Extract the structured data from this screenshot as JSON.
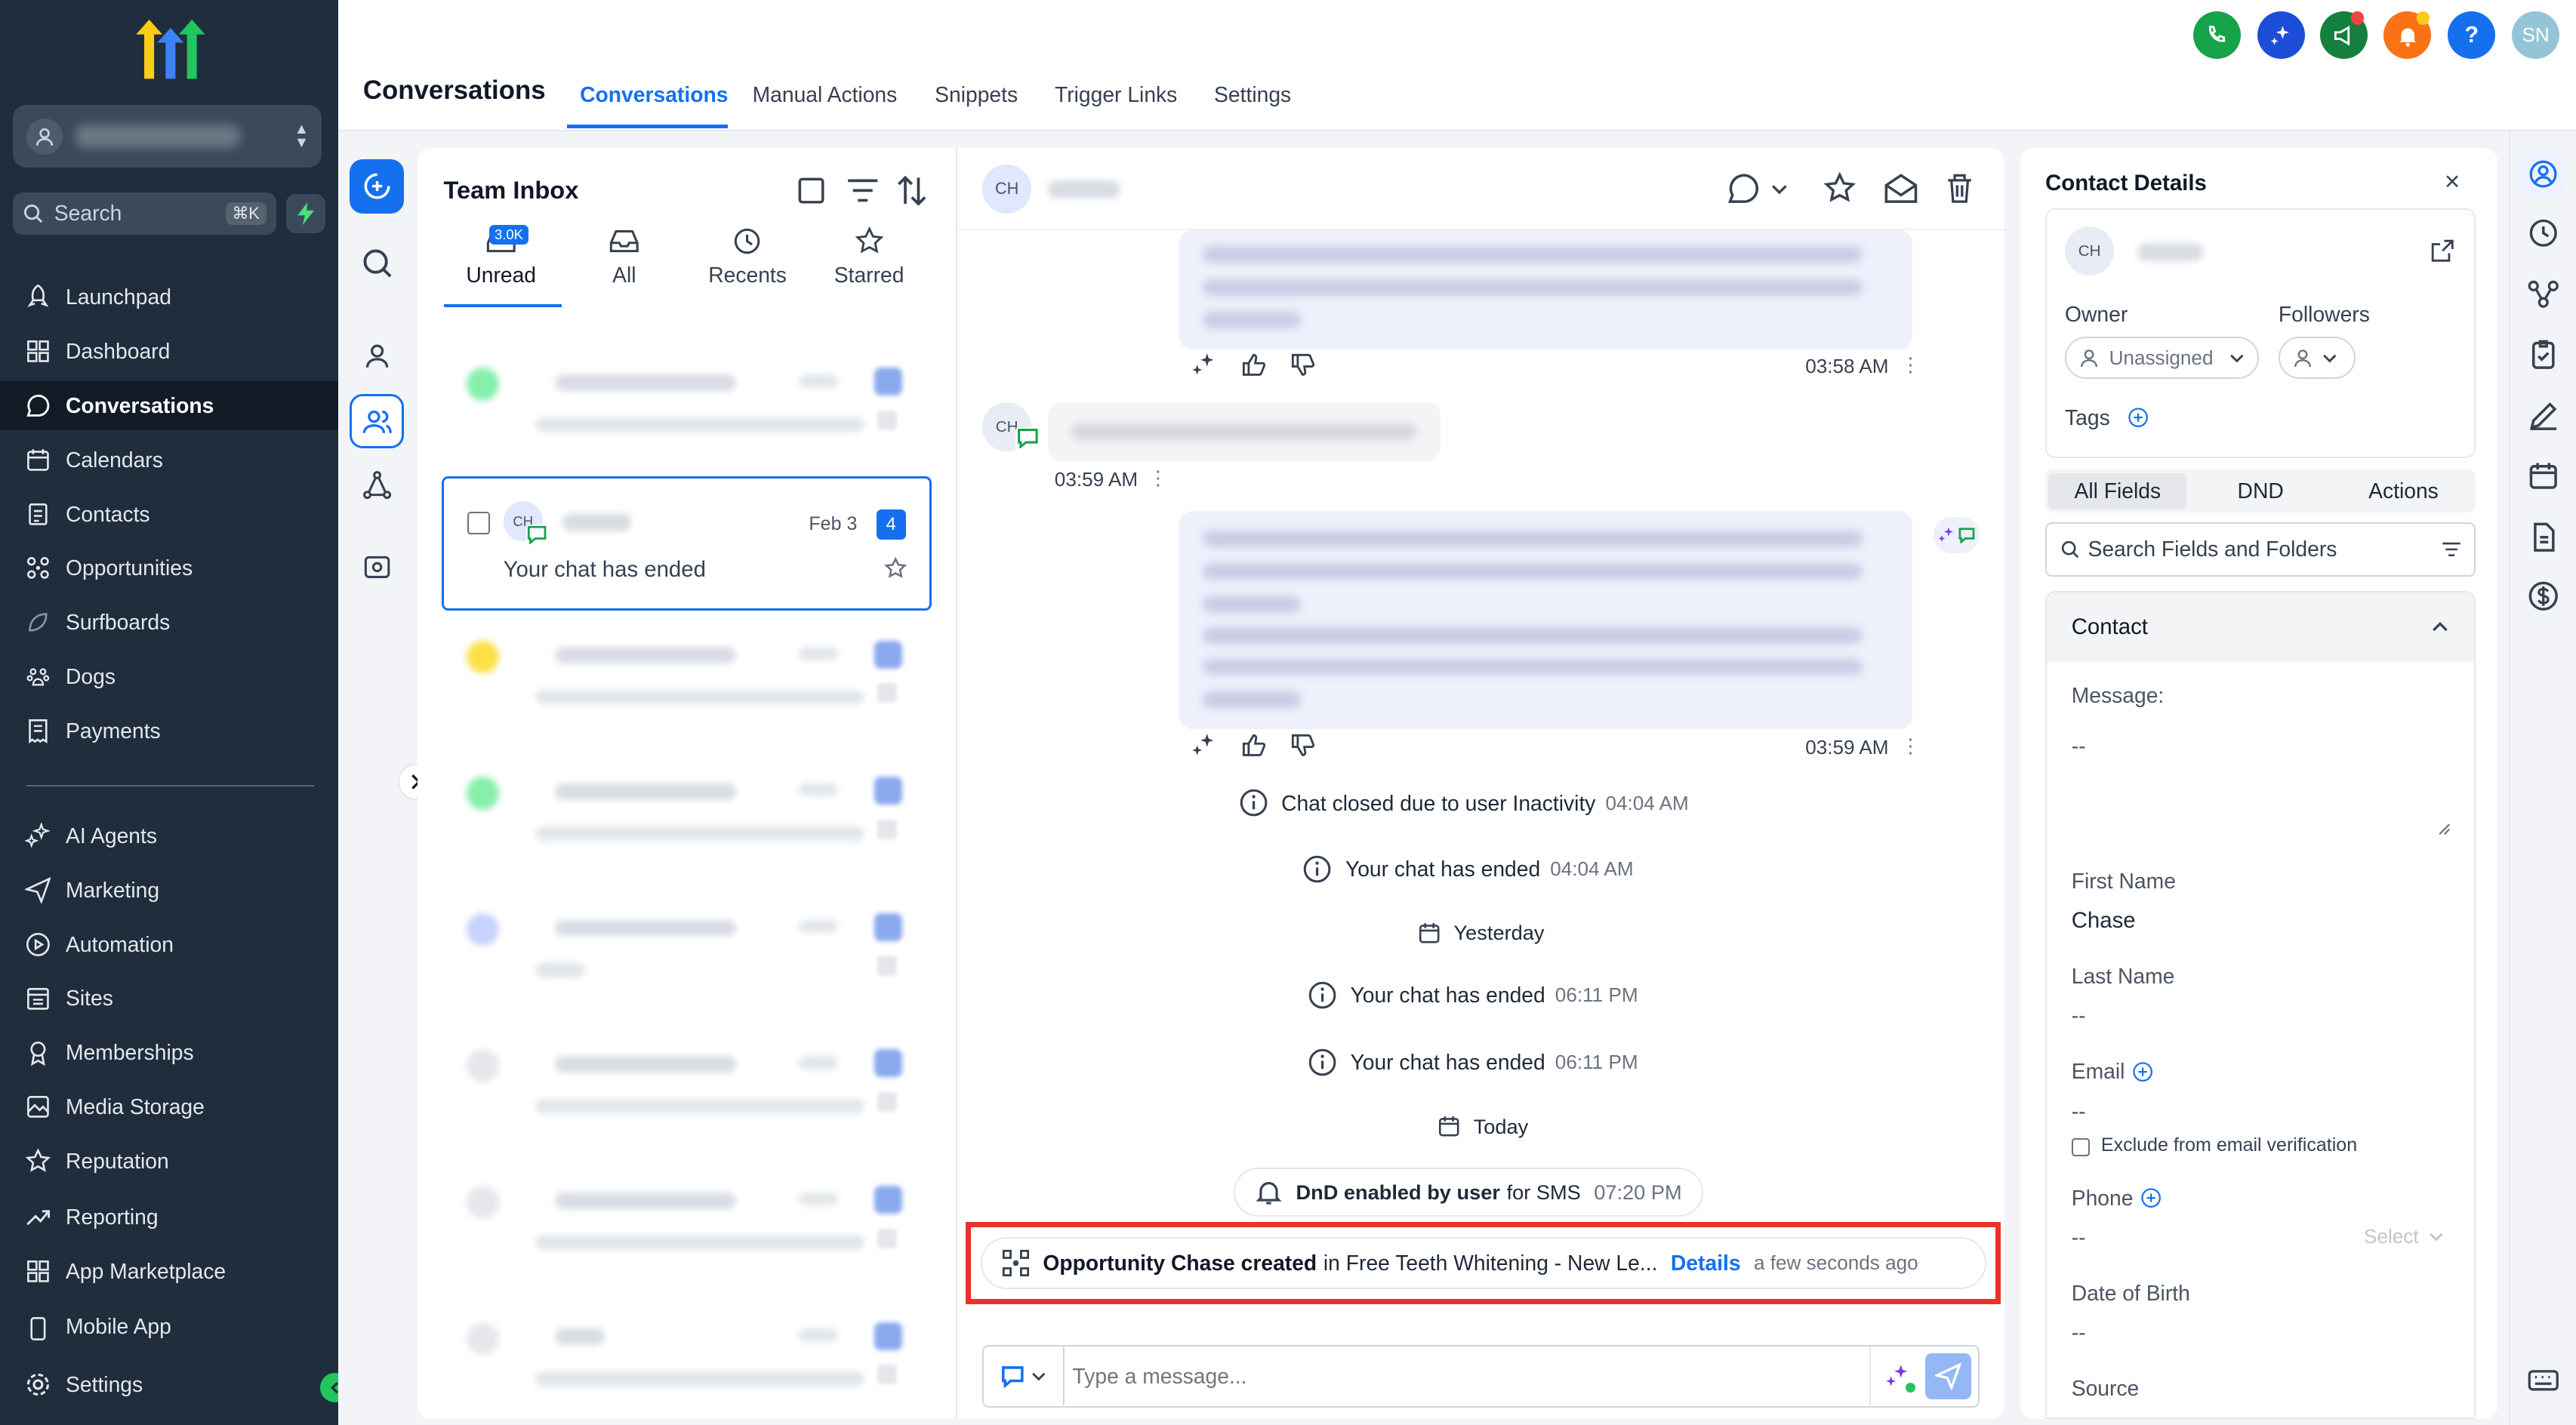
{
  "sidebar": {
    "account_initial_icon": "user-icon",
    "search": {
      "placeholder": "Search",
      "shortcut": "⌘K"
    },
    "nav": [
      {
        "id": "launchpad",
        "label": "Launchpad",
        "icon": "rocket-icon"
      },
      {
        "id": "dashboard",
        "label": "Dashboard",
        "icon": "grid-icon"
      },
      {
        "id": "conversations",
        "label": "Conversations",
        "icon": "chat-icon",
        "active": true
      },
      {
        "id": "calendars",
        "label": "Calendars",
        "icon": "calendar-icon"
      },
      {
        "id": "contacts",
        "label": "Contacts",
        "icon": "contacts-icon"
      },
      {
        "id": "opportunities",
        "label": "Opportunities",
        "icon": "opportunity-icon"
      },
      {
        "id": "surfboards",
        "label": "Surfboards",
        "icon": "surfboard-icon"
      },
      {
        "id": "dogs",
        "label": "Dogs",
        "icon": "paw-icon"
      },
      {
        "id": "payments",
        "label": "Payments",
        "icon": "receipt-icon"
      },
      {
        "id": "ai-agents",
        "label": "AI Agents",
        "icon": "sparkle-icon"
      },
      {
        "id": "marketing",
        "label": "Marketing",
        "icon": "send-icon"
      },
      {
        "id": "automation",
        "label": "Automation",
        "icon": "play-circle-icon"
      },
      {
        "id": "sites",
        "label": "Sites",
        "icon": "sites-icon"
      },
      {
        "id": "memberships",
        "label": "Memberships",
        "icon": "membership-icon"
      },
      {
        "id": "media-storage",
        "label": "Media Storage",
        "icon": "image-icon"
      },
      {
        "id": "reputation",
        "label": "Reputation",
        "icon": "star-icon"
      },
      {
        "id": "reporting",
        "label": "Reporting",
        "icon": "trend-icon"
      },
      {
        "id": "app-marketplace",
        "label": "App Marketplace",
        "icon": "grid-icon"
      },
      {
        "id": "mobile-app",
        "label": "Mobile App",
        "icon": "mobile-icon"
      }
    ],
    "settings_label": "Settings"
  },
  "header": {
    "title": "Conversations",
    "tabs": [
      "Conversations",
      "Manual Actions",
      "Snippets",
      "Trigger Links",
      "Settings"
    ],
    "active_tab": "Conversations",
    "user_initials": "SN",
    "help_label": "?"
  },
  "inbox": {
    "title": "Team Inbox",
    "tabs": [
      {
        "label": "Unread",
        "badge": "3.0K"
      },
      {
        "label": "All"
      },
      {
        "label": "Recents"
      },
      {
        "label": "Starred"
      }
    ],
    "selected": {
      "initials": "CH",
      "date": "Feb 3",
      "count": "4",
      "preview": "Your chat has ended"
    }
  },
  "chat": {
    "header_initials": "CH",
    "messages": [
      {
        "time": "03:58 AM"
      },
      {
        "time": "03:59 AM",
        "initials": "CH"
      },
      {
        "time": "03:59 AM"
      }
    ],
    "system": [
      {
        "text": "Chat closed due to user Inactivity",
        "time": "04:04 AM"
      },
      {
        "text": "Your chat has ended",
        "time": "04:04 AM"
      },
      {
        "text": "Yesterday"
      },
      {
        "text": "Your chat has ended",
        "time": "06:11 PM"
      },
      {
        "text": "Your chat has ended",
        "time": "06:11 PM"
      },
      {
        "text": "Today"
      }
    ],
    "dnd": {
      "bold": "DnD enabled by user",
      "rest": "for SMS",
      "time": "07:20 PM"
    },
    "opportunity": {
      "bold": "Opportunity Chase created",
      "rest": "in Free Teeth Whitening - New Le...",
      "link": "Details",
      "time": "a few seconds ago"
    },
    "composer": {
      "placeholder": "Type a message..."
    }
  },
  "contact": {
    "title": "Contact Details",
    "initials": "CH",
    "owner_label": "Owner",
    "owner_value": "Unassigned",
    "followers_label": "Followers",
    "tags_label": "Tags",
    "field_tabs": [
      "All Fields",
      "DND",
      "Actions"
    ],
    "search_placeholder": "Search Fields and Folders",
    "section": "Contact",
    "fields": {
      "message_label": "Message:",
      "message_value": "--",
      "first_name_label": "First Name",
      "first_name_value": "Chase",
      "last_name_label": "Last Name",
      "last_name_value": "--",
      "email_label": "Email",
      "email_value": "--",
      "exclude_label": "Exclude from email verification",
      "phone_label": "Phone",
      "phone_value": "--",
      "phone_select": "Select",
      "dob_label": "Date of Birth",
      "dob_value": "--",
      "source_label": "Source"
    }
  },
  "colors": {
    "accent": "#1570ef",
    "sidebar": "#1f2d3d",
    "highlight": "#e8322b"
  }
}
